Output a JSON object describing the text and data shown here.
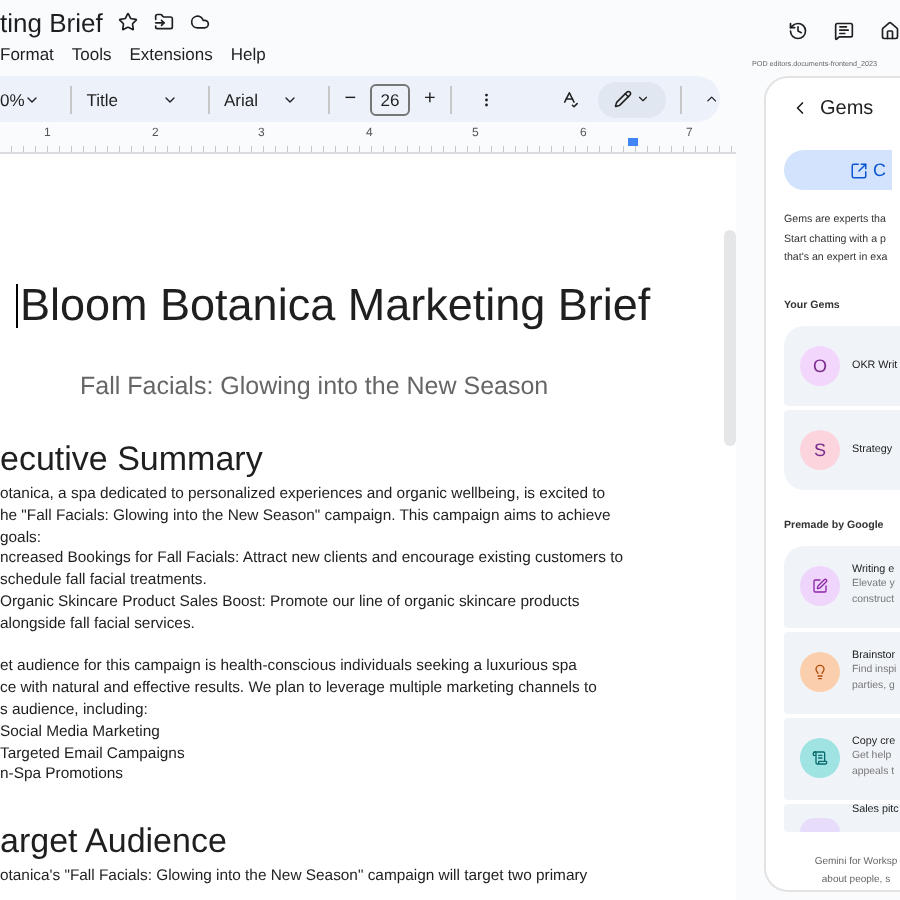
{
  "header": {
    "title": "ting Brief",
    "menu": [
      "Format",
      "Tools",
      "Extensions",
      "Help"
    ]
  },
  "toolbar": {
    "zoom": "0%",
    "style": "Title",
    "font": "Arial",
    "size": "26",
    "minus": "−",
    "plus": "+"
  },
  "ruler": {
    "numbers": [
      "1",
      "2",
      "3",
      "4",
      "5",
      "6",
      "7"
    ]
  },
  "document": {
    "blocks": [
      {
        "kind": "title",
        "lines": [
          "Bloom Botanica Marketing Brief"
        ]
      },
      {
        "kind": "subtitle",
        "lines": [
          "Fall Facials: Glowing into the New Season"
        ]
      },
      {
        "kind": "heading",
        "lines": [
          "ecutive Summary"
        ]
      },
      {
        "kind": "paragraph",
        "lines": [
          "otanica, a spa dedicated to personalized experiences and organic wellbeing, is excited to",
          "he \"Fall Facials: Glowing into the New Season\" campaign. This campaign aims to achieve",
          "goals:"
        ]
      },
      {
        "kind": "list_item",
        "lines": [
          "ncreased Bookings for Fall Facials: Attract new clients and encourage existing customers to",
          "schedule fall facial treatments."
        ]
      },
      {
        "kind": "list_item",
        "lines": [
          "Organic Skincare Product Sales Boost:  Promote our line of organic skincare products",
          "alongside fall facial services."
        ]
      },
      {
        "kind": "paragraph",
        "lines": [
          "et audience for this campaign is health-conscious individuals seeking a luxurious spa",
          "ce with natural and effective results. We plan to leverage multiple marketing channels to",
          "s audience, including:"
        ]
      },
      {
        "kind": "list_item",
        "lines": [
          "Social Media Marketing"
        ]
      },
      {
        "kind": "list_item",
        "lines": [
          "Targeted Email Campaigns"
        ]
      },
      {
        "kind": "list_item",
        "lines": [
          "n-Spa Promotions"
        ]
      },
      {
        "kind": "heading",
        "lines": [
          "arget Audience"
        ]
      },
      {
        "kind": "paragraph",
        "lines": [
          "otanica's \"Fall Facials: Glowing into the New Season\" campaign will target two primary"
        ]
      }
    ]
  },
  "path_label": "POD editors.documents-frontend_2023",
  "gems_panel": {
    "title": "Gems",
    "create_button": "C",
    "description": [
      "Gems are experts tha",
      "Start chatting with a p",
      "that's an expert in exa"
    ],
    "your_gems_label": "Your Gems",
    "your_gems": [
      {
        "initial": "O",
        "name": "OKR Writ",
        "color": "#f3d6fb"
      },
      {
        "initial": "S",
        "name": "Strategy",
        "color": "#fcd4de"
      }
    ],
    "premade_label": "Premade by Google",
    "premade": [
      {
        "kind": "edit",
        "name": "Writing e",
        "description": [
          "Elevate y",
          "construct"
        ],
        "color": "#efd5fb"
      },
      {
        "kind": "bulb",
        "name": "Brainstor",
        "description": [
          "Find inspi",
          "parties, g"
        ],
        "color": "#fbcfae"
      },
      {
        "kind": "document",
        "name": "Copy cre",
        "description": [
          "Get help",
          "appeals t"
        ],
        "color": "#9fe3e3"
      },
      {
        "kind": "partial",
        "name": "Sales pitc",
        "color": "#e8dcfb"
      }
    ],
    "footer": [
      "Gemini for Worksp",
      "about people, s"
    ]
  }
}
